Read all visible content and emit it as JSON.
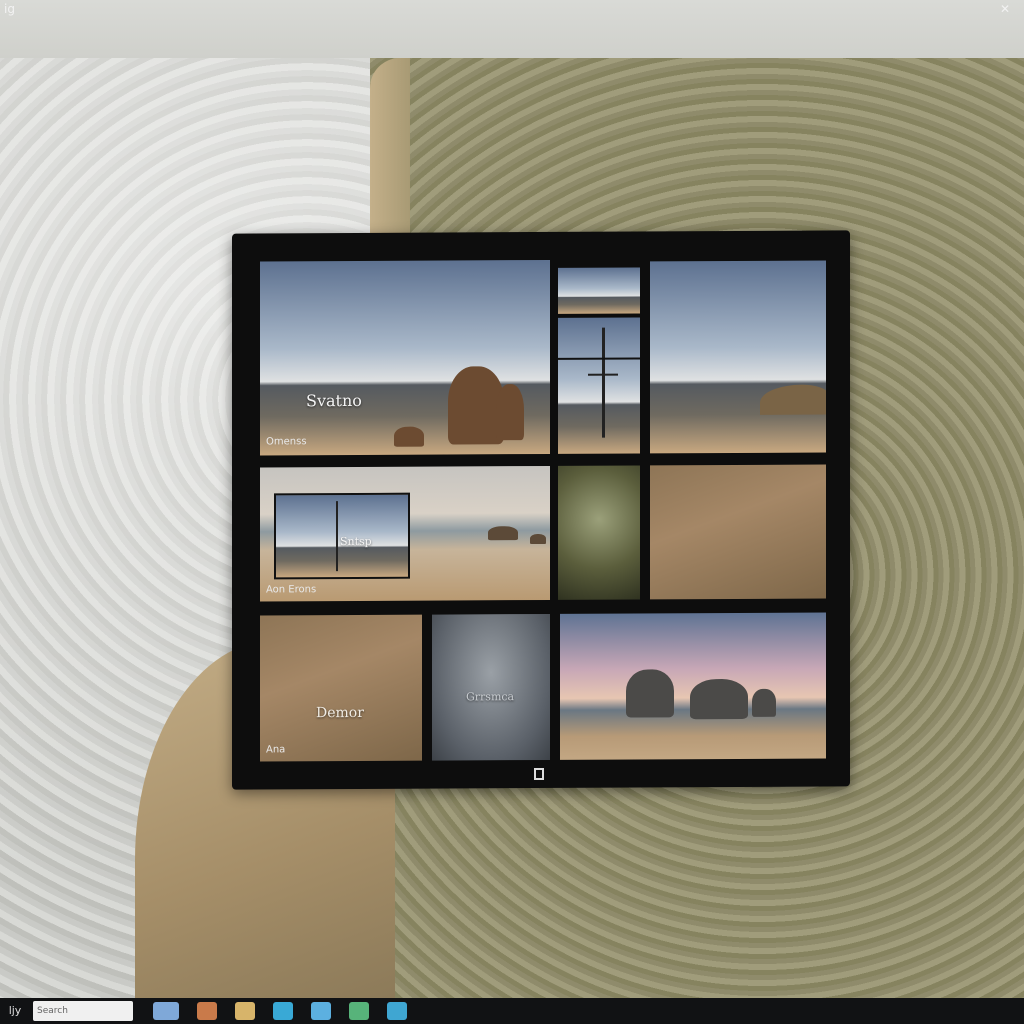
{
  "desktop": {
    "top_left_glyph": "ig",
    "top_right_glyph": "✕"
  },
  "grid": {
    "tile1": {
      "title": "Svatno",
      "subtitle": "Omenss"
    },
    "tile_mid_left": {
      "inset_label": "Sntsp",
      "subtitle": "Aon Erons"
    },
    "tile_bottom_left": {
      "title": "Demor",
      "subtitle": "Ana"
    },
    "tile_bottom_mid": {
      "title": "Grrsmca"
    },
    "footer_icon": "square-icon"
  },
  "taskbar": {
    "start_label": "ljy",
    "search_placeholder": "Search",
    "icons": [
      {
        "name": "app-1-icon",
        "color": "#7fa8d8"
      },
      {
        "name": "app-2-icon",
        "color": "#c97a4a"
      },
      {
        "name": "app-3-icon",
        "color": "#d7b46a"
      },
      {
        "name": "app-4-icon",
        "color": "#39a9d6"
      },
      {
        "name": "app-5-icon",
        "color": "#5cb0e0"
      },
      {
        "name": "app-6-icon",
        "color": "#57b37a"
      },
      {
        "name": "app-7-icon",
        "color": "#3fa6d2"
      }
    ]
  }
}
